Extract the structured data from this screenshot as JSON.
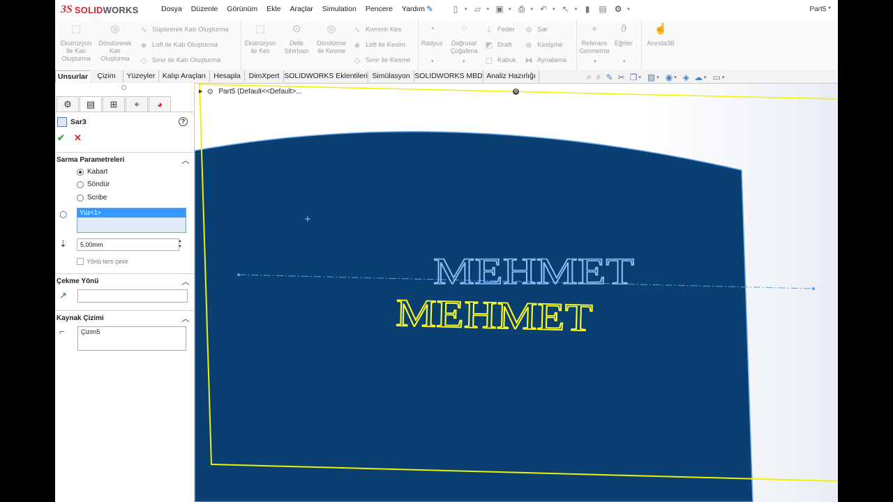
{
  "app": {
    "logo_ds": "3S",
    "logo_text": "SOLID",
    "logo_text_bold": "WORKS",
    "doc_title": "Part5 *"
  },
  "menu": [
    "Dosya",
    "Düzenle",
    "Görünüm",
    "Ekle",
    "Araçlar",
    "Simulation",
    "Pencere",
    "Yardım"
  ],
  "commands": {
    "extrude_boss": "Ekstrüzyon İle Katı Oluşturma",
    "revolve_boss": "Döndürerek Katı Oluşturma",
    "sweep_boss": "Süpürerek Katı Oluşturma",
    "loft_boss": "Loft ile Katı Oluşturma",
    "boundary_boss": "Sınır ile Katı Oluşturma",
    "extrude_cut": "Ekstrüzyon ile Kes",
    "hole_wizard": "Delik Sihirbazı",
    "revolve_cut": "Döndürme ile Kesme",
    "swept_cut": "Kıvrımlı Kes",
    "loft_cut": "Loft ile Kesim",
    "boundary_cut": "Sınır ile Kesme",
    "fillet": "Radyus",
    "linear_pattern": "Doğrusal Çoğaltma",
    "rib": "Feder",
    "draft": "Draft",
    "shell": "Kabuk",
    "wrap": "Sar",
    "intersect": "Kesişme",
    "mirror": "Aynalama",
    "ref_geometry": "Referans Geometrisi",
    "curves": "Eğriler",
    "instant3d": "Anında3B"
  },
  "tabs": [
    "Unsurlar",
    "Çizim",
    "Yüzeyler",
    "Kalıp Araçları",
    "Hesapla",
    "DimXpert",
    "SOLIDWORKS Eklentileri",
    "Simülasyon",
    "SOLIDWORKS MBD",
    "Analiz Hazırlığı"
  ],
  "panel": {
    "feature_name": "Sar3",
    "help": "?",
    "ok": "✔",
    "cancel": "✕",
    "sec_params": "Sarma Parametreleri",
    "opt_emboss": "Kabart",
    "opt_deboss": "Söndür",
    "opt_scribe": "Scribe",
    "selected_option": "Kabart",
    "face": "Yüz<1>",
    "depth": "5.00mm",
    "reverse": "Yönü ters çevir",
    "sec_pull": "Çekme Yönü",
    "sec_source": "Kaynak Çizimi",
    "sketch": "Çizim5"
  },
  "viewport": {
    "tree_label": "Part5  (Default<<Default>...",
    "text_preview": "MEHMET",
    "text_sketch": "MEHMET",
    "colors": {
      "face": "#0a3f72",
      "preview_outline": "#8ec0ff",
      "sketch_outline": "#ffff22",
      "plane": "#ffff00"
    }
  }
}
